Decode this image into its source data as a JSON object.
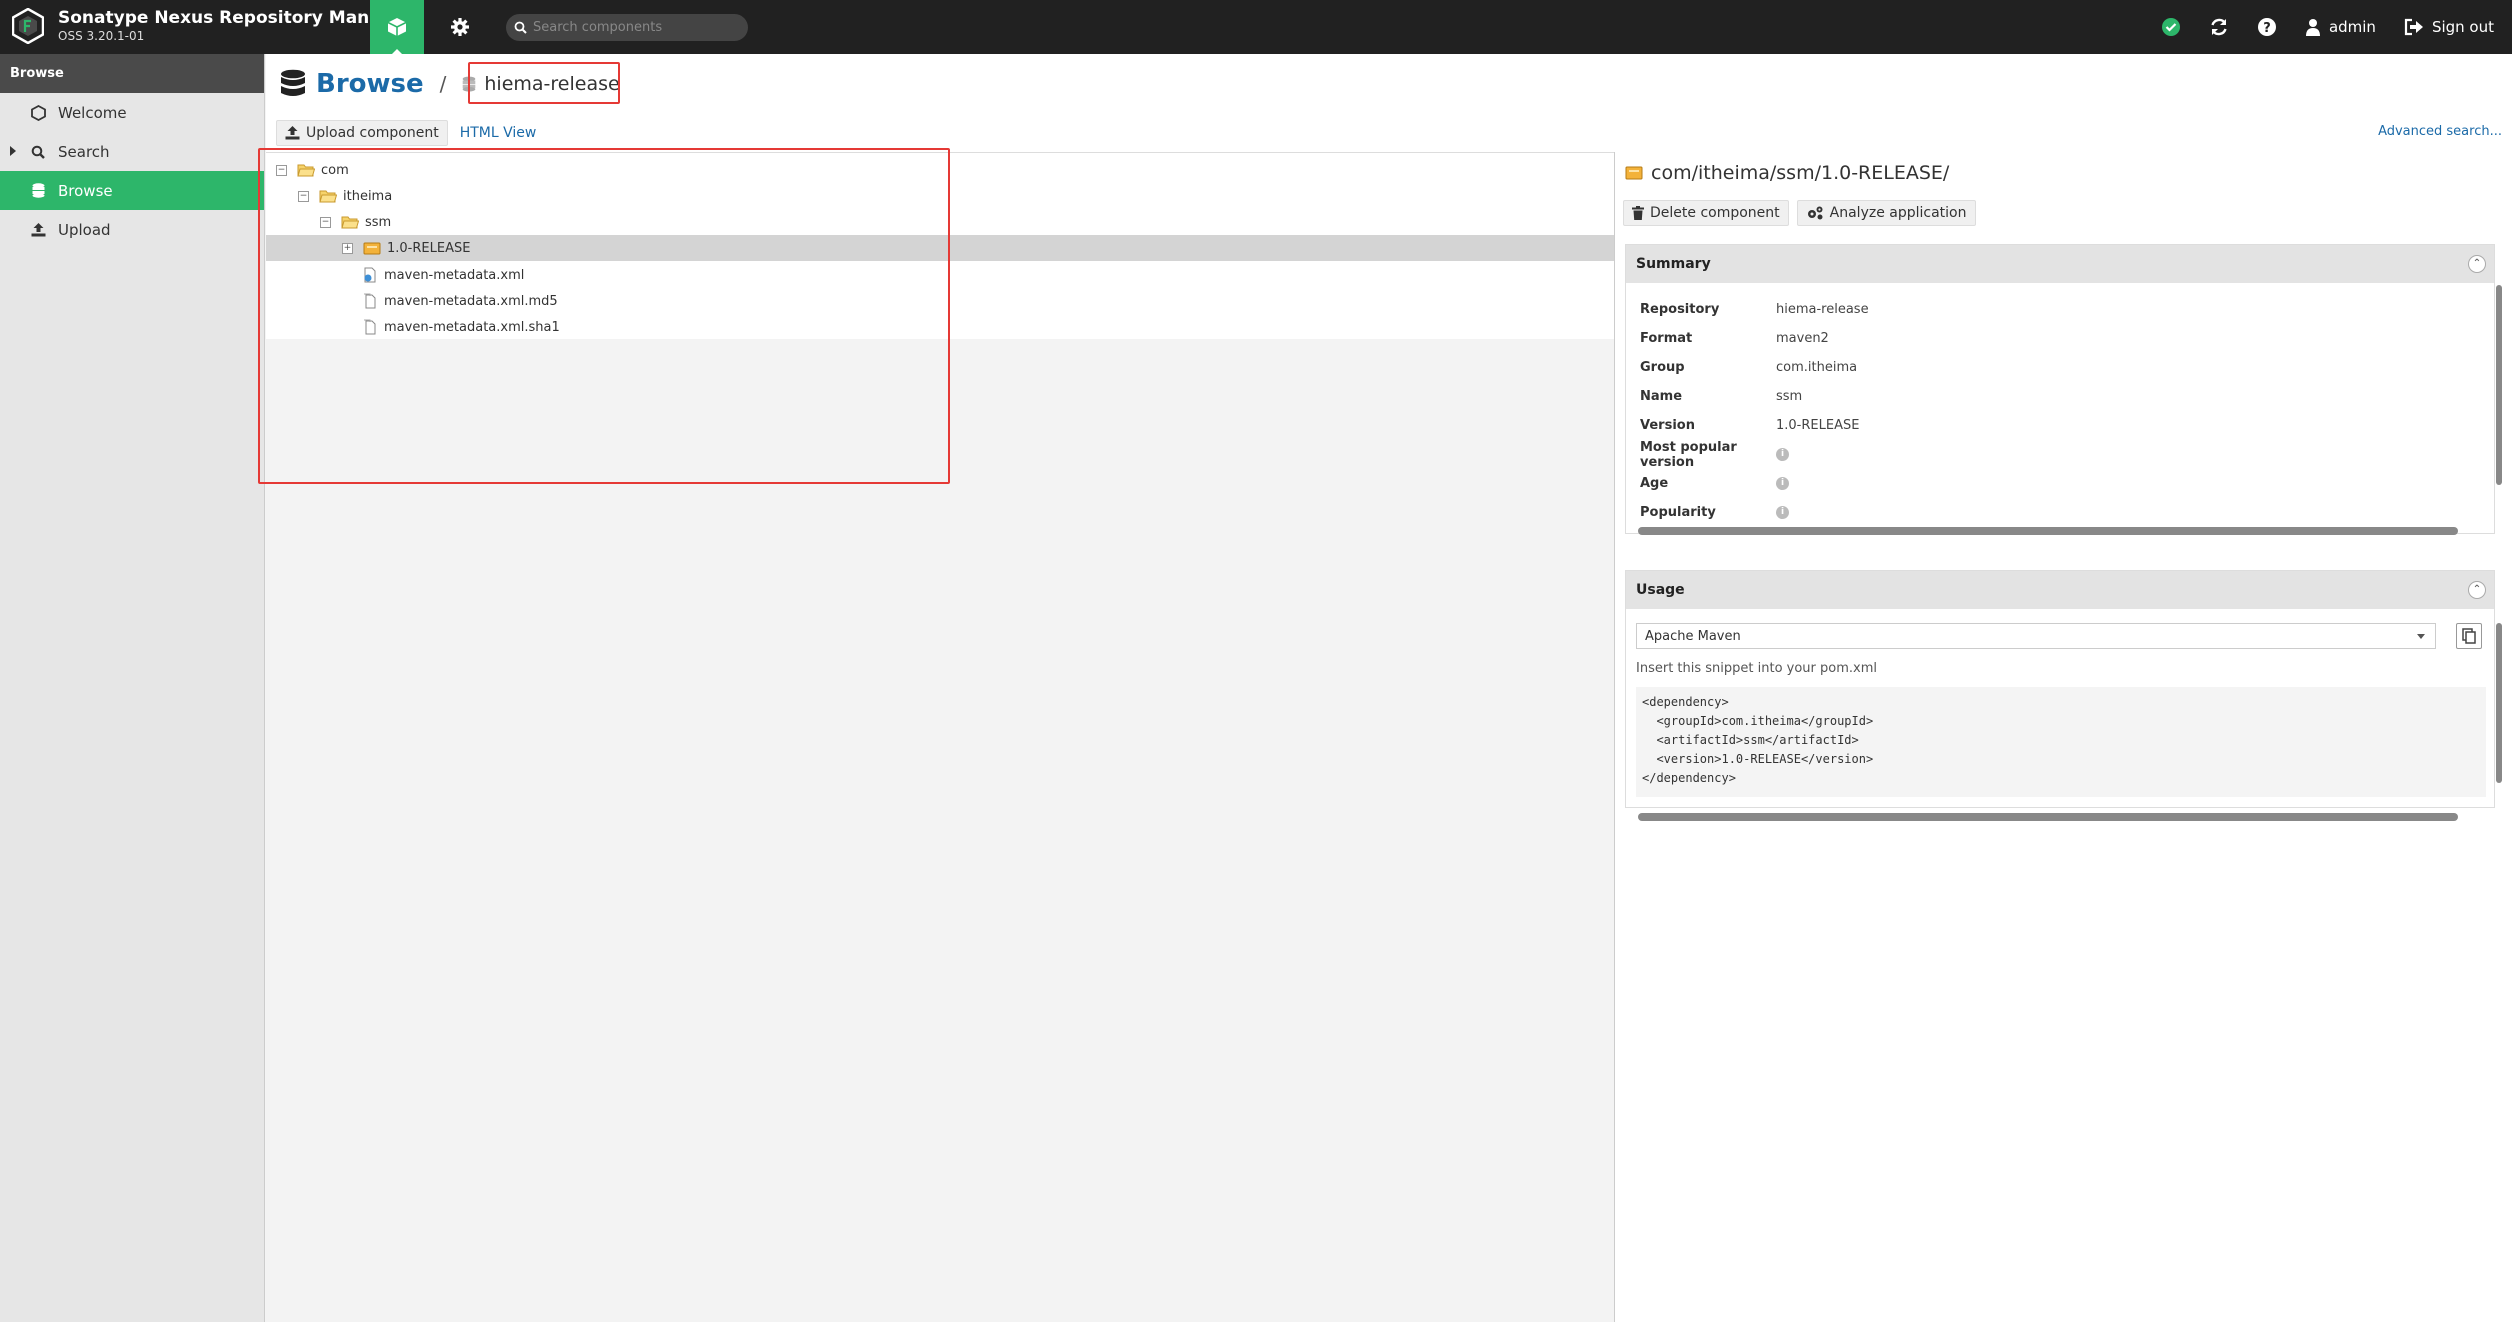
{
  "header": {
    "app_title": "Sonatype Nexus Repository Manager",
    "version": "OSS 3.20.1-01",
    "search_placeholder": "Search components",
    "user": "admin",
    "signout_label": "Sign out",
    "status_color": "#2db66a"
  },
  "sidebar": {
    "heading": "Browse",
    "items": [
      {
        "label": "Welcome",
        "icon": "hexagon-icon"
      },
      {
        "label": "Search",
        "icon": "search-icon"
      },
      {
        "label": "Browse",
        "icon": "database-icon",
        "active": true
      },
      {
        "label": "Upload",
        "icon": "upload-icon"
      }
    ]
  },
  "main": {
    "breadcrumb_title": "Browse",
    "breadcrumb_sep": "/",
    "repository": "hiema-release",
    "upload_label": "Upload component",
    "html_view_label": "HTML View",
    "advanced_search_label": "Advanced search..."
  },
  "tree": {
    "rows": [
      {
        "label": "com",
        "type": "folder"
      },
      {
        "label": "itheima",
        "type": "folder"
      },
      {
        "label": "ssm",
        "type": "folder"
      },
      {
        "label": "1.0-RELEASE",
        "type": "component",
        "selected": true
      },
      {
        "label": "maven-metadata.xml",
        "type": "file"
      },
      {
        "label": "maven-metadata.xml.md5",
        "type": "file"
      },
      {
        "label": "maven-metadata.xml.sha1",
        "type": "file"
      }
    ]
  },
  "detail": {
    "path": "com/itheima/ssm/1.0-RELEASE/",
    "delete_label": "Delete component",
    "analyze_label": "Analyze application",
    "summary": {
      "heading": "Summary",
      "fields": [
        {
          "key": "Repository",
          "value": "hiema-release"
        },
        {
          "key": "Format",
          "value": "maven2"
        },
        {
          "key": "Group",
          "value": "com.itheima"
        },
        {
          "key": "Name",
          "value": "ssm"
        },
        {
          "key": "Version",
          "value": "1.0-RELEASE"
        },
        {
          "key": "Most popular version",
          "value": ""
        },
        {
          "key": "Age",
          "value": ""
        },
        {
          "key": "Popularity",
          "value": ""
        }
      ]
    },
    "usage": {
      "heading": "Usage",
      "selected_tool": "Apache Maven",
      "hint": "Insert this snippet into your pom.xml",
      "snippet": "<dependency>\n  <groupId>com.itheima</groupId>\n  <artifactId>ssm</artifactId>\n  <version>1.0-RELEASE</version>\n</dependency>"
    }
  }
}
